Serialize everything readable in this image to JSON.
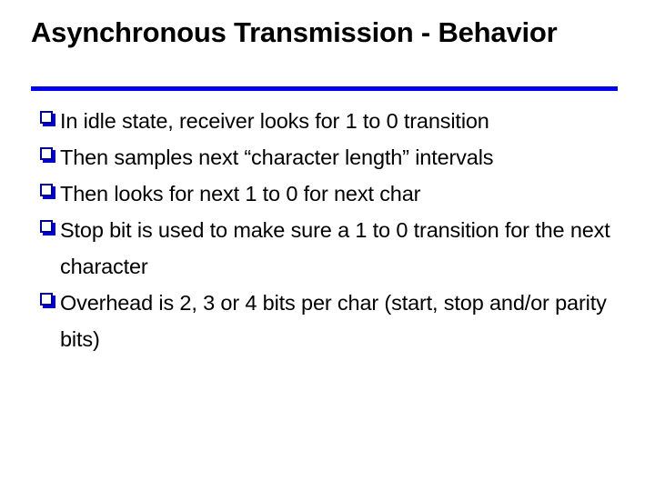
{
  "slide": {
    "title": "Asynchronous Transmission - Behavior",
    "title_line_1": "Asynchronous Transmission -",
    "title_line_2": "Behavior",
    "accent_color": "#0000F0",
    "bullet_outline_color": "#00008C",
    "bullet_shadow_color": "#0000E0",
    "text_color": "#000000",
    "background_color": "#FFFFFF",
    "bullet_icon": "hollow-square-bullet",
    "bullets": [
      {
        "text": "In idle state, receiver looks for 1 to 0 transition"
      },
      {
        "text": "Then samples next “character length” intervals"
      },
      {
        "text": "Then looks for next 1 to 0 for next char"
      },
      {
        "text": "Stop bit is used to make sure a 1 to 0 transition for the next character"
      },
      {
        "text": "Overhead is 2, 3 or 4 bits per char (start, stop and/or parity bits)"
      }
    ]
  }
}
